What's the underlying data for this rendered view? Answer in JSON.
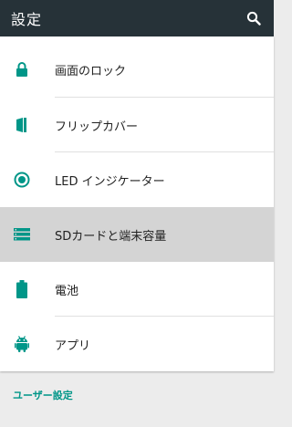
{
  "appbar": {
    "title": "設定",
    "search_icon": "search-icon"
  },
  "accent_color": "#009688",
  "items": [
    {
      "label": "画面のロック",
      "icon": "lock-icon"
    },
    {
      "label": "フリップカバー",
      "icon": "flip-cover-icon"
    },
    {
      "label": "LED インジケーター",
      "icon": "led-indicator-icon"
    },
    {
      "label": "SDカードと端末容量",
      "icon": "storage-icon",
      "selected": true
    },
    {
      "label": "電池",
      "icon": "battery-icon"
    },
    {
      "label": "アプリ",
      "icon": "android-icon"
    }
  ],
  "section": {
    "title": "ユーザー設定"
  }
}
